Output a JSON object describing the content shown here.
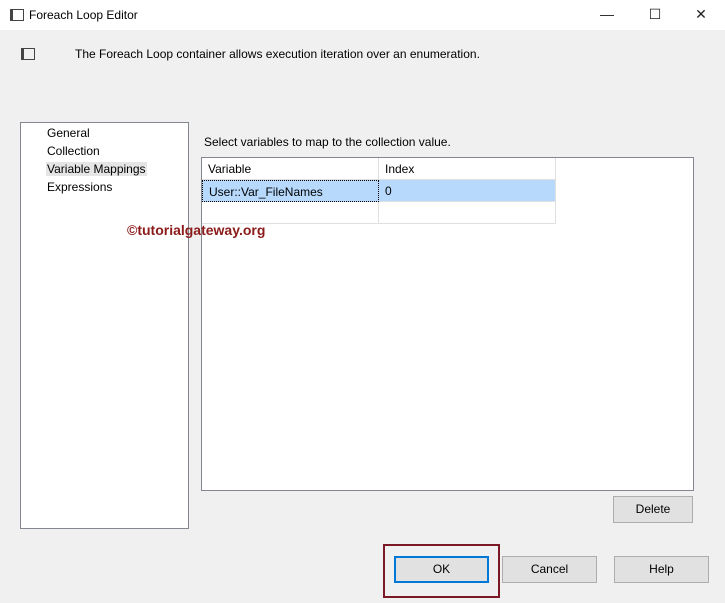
{
  "window": {
    "title": "Foreach Loop Editor",
    "minimize": "—",
    "maximize": "☐",
    "close": "✕"
  },
  "header": {
    "description": "The Foreach Loop container allows execution iteration over an enumeration."
  },
  "nav": {
    "items": [
      "General",
      "Collection",
      "Variable Mappings",
      "Expressions"
    ],
    "selected": "Variable Mappings"
  },
  "main": {
    "prompt": "Select variables to map to the collection value.",
    "columns": [
      "Variable",
      "Index"
    ],
    "rows": [
      {
        "variable": "User::Var_FileNames",
        "index": "0"
      }
    ],
    "delete_label": "Delete"
  },
  "watermark": "©tutorialgateway.org",
  "buttons": {
    "ok": "OK",
    "cancel": "Cancel",
    "help": "Help"
  },
  "colors": {
    "selection": "#b7d9fc",
    "highlight_box": "#7b1a26",
    "ok_border": "#0078d7"
  }
}
